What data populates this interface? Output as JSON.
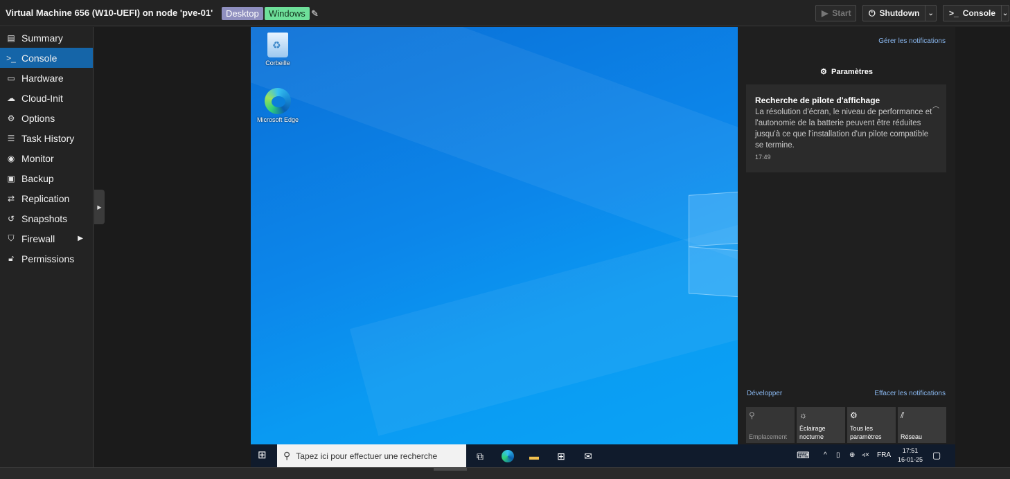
{
  "header": {
    "title": "Virtual Machine 656 (W10-UEFI) on node 'pve-01'",
    "tags": [
      "Desktop",
      "Windows"
    ],
    "buttons": {
      "start": "Start",
      "shutdown": "Shutdown",
      "console": "Console"
    }
  },
  "sidebar": {
    "items": [
      {
        "label": "Summary",
        "icon": "book-icon"
      },
      {
        "label": "Console",
        "icon": "terminal-icon"
      },
      {
        "label": "Hardware",
        "icon": "monitor-icon"
      },
      {
        "label": "Cloud-Init",
        "icon": "cloud-icon"
      },
      {
        "label": "Options",
        "icon": "gear-icon"
      },
      {
        "label": "Task History",
        "icon": "list-icon"
      },
      {
        "label": "Monitor",
        "icon": "eye-icon"
      },
      {
        "label": "Backup",
        "icon": "floppy-icon"
      },
      {
        "label": "Replication",
        "icon": "retweet-icon"
      },
      {
        "label": "Snapshots",
        "icon": "history-icon"
      },
      {
        "label": "Firewall",
        "icon": "shield-icon"
      },
      {
        "label": "Permissions",
        "icon": "unlock-icon"
      }
    ],
    "active": "Console"
  },
  "desktop": {
    "icons": [
      "Corbeille",
      "Microsoft Edge"
    ]
  },
  "action_center": {
    "manage_link": "Gérer les notifications",
    "group_title": "Paramètres",
    "notification": {
      "title": "Recherche de pilote d'affichage",
      "body": "La résolution d'écran, le niveau de performance et l'autonomie de la batterie peuvent être réduites jusqu'à ce que l'installation d'un pilote compatible se termine.",
      "time": "17:49"
    },
    "expand_link": "Développer",
    "clear_link": "Effacer les notifications",
    "quick_actions": [
      "Emplacement",
      "Éclairage nocturne",
      "Tous les paramètres",
      "Réseau"
    ]
  },
  "taskbar": {
    "search_placeholder": "Tapez ici pour effectuer une recherche",
    "lang": "FRA",
    "time": "17:51",
    "date": "16-01-25"
  }
}
